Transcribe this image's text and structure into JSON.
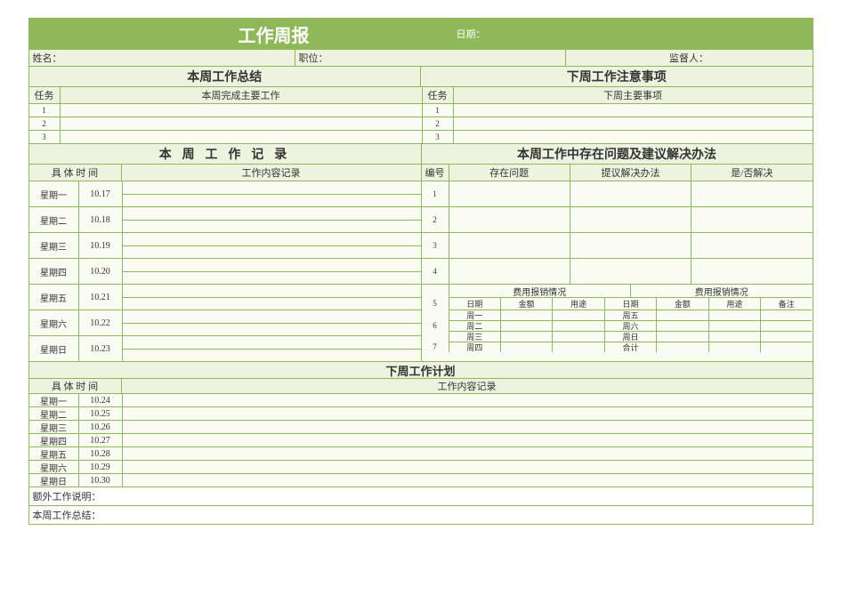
{
  "header": {
    "title": "工作周报",
    "date_label": "日期：",
    "name_label": "姓名：",
    "position_label": "职位：",
    "supervisor_label": "监督人："
  },
  "summary": {
    "left_title": "本周工作总结",
    "right_title": "下周工作注意事项",
    "task_label": "任务",
    "left_sub": "本周完成主要工作",
    "right_sub": "下周主要事项",
    "task_nums": [
      "1",
      "2",
      "3"
    ]
  },
  "records": {
    "left_title": "本 周 工 作 记 录",
    "right_title": "本周工作中存在问题及建议解决办法",
    "time_label": "具 体 时 间",
    "content_label": "工作内容记录",
    "num_label": "编号",
    "problem_label": "存在问题",
    "suggest_label": "提议解决办法",
    "resolved_label": "是/否解决",
    "days": [
      {
        "day": "星期一",
        "date": "10.17"
      },
      {
        "day": "星期二",
        "date": "10.18"
      },
      {
        "day": "星期三",
        "date": "10.19"
      },
      {
        "day": "星期四",
        "date": "10.20"
      },
      {
        "day": "星期五",
        "date": "10.21"
      },
      {
        "day": "星期六",
        "date": "10.22"
      },
      {
        "day": "星期日",
        "date": "10.23"
      }
    ],
    "problem_nums": [
      "1",
      "2",
      "3",
      "4"
    ],
    "expense": {
      "title": "费用报销情况",
      "cols_left": [
        "日期",
        "金额",
        "用途"
      ],
      "cols_right": [
        "日期",
        "金额",
        "用途",
        "备注"
      ],
      "rows_left": [
        "周一",
        "周二",
        "周三",
        "周四"
      ],
      "rows_right": [
        "周五",
        "周六",
        "周日",
        "合计"
      ],
      "side_nums": [
        "5",
        "",
        "6",
        "",
        "7",
        ""
      ]
    }
  },
  "plan": {
    "title": "下周工作计划",
    "time_label": "具 体 时 间",
    "content_label": "工作内容记录",
    "days": [
      {
        "day": "星期一",
        "date": "10.24"
      },
      {
        "day": "星期二",
        "date": "10.25"
      },
      {
        "day": "星期三",
        "date": "10.26"
      },
      {
        "day": "星期四",
        "date": "10.27"
      },
      {
        "day": "星期五",
        "date": "10.28"
      },
      {
        "day": "星期六",
        "date": "10.29"
      },
      {
        "day": "星期日",
        "date": "10.30"
      }
    ]
  },
  "footer": {
    "extra_label": "额外工作说明：",
    "summary_label": "本周工作总结："
  }
}
